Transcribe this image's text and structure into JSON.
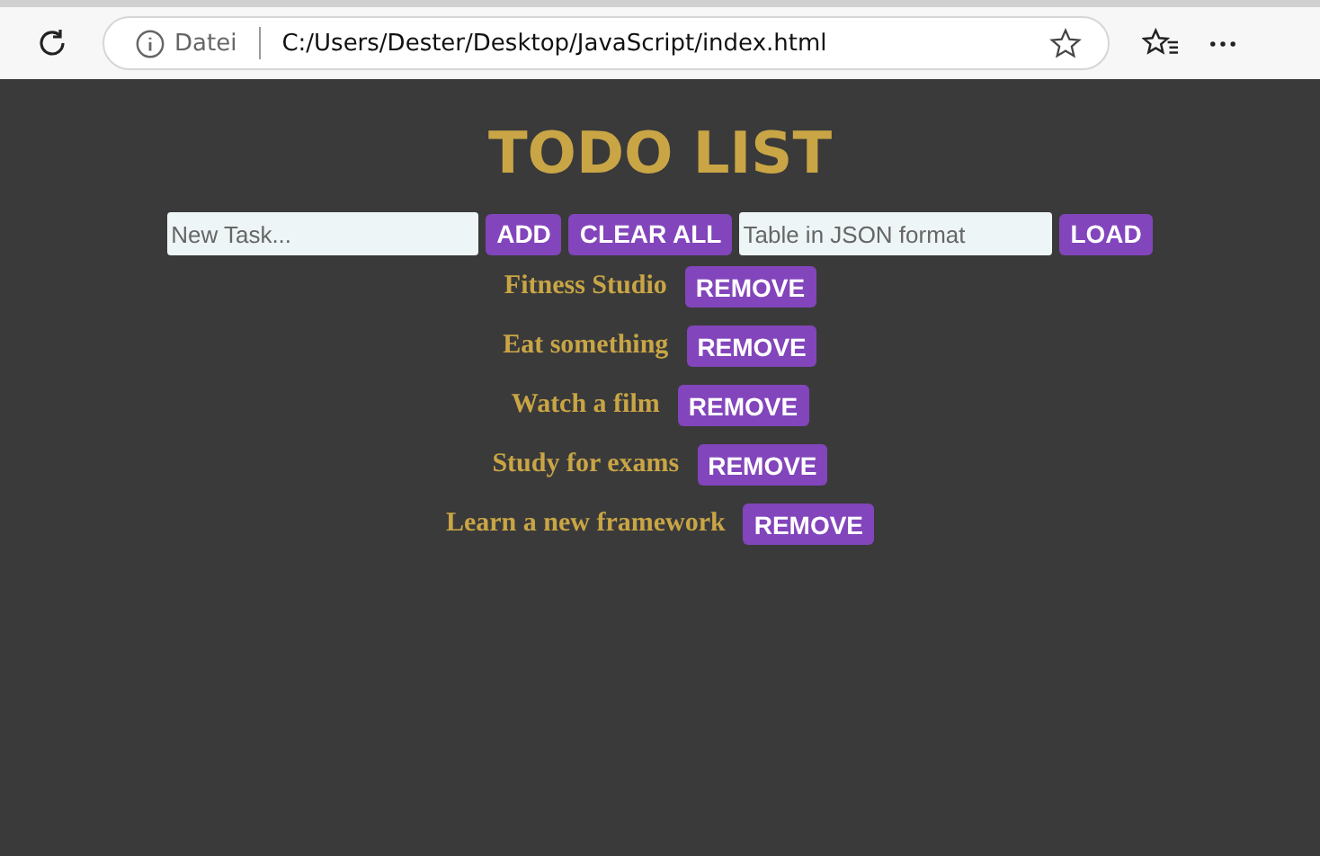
{
  "browser": {
    "site_label": "Datei",
    "address": "C:/Users/Dester/Desktop/JavaScript/index.html"
  },
  "page": {
    "title": "TODO LIST",
    "controls": [
      {
        "kind": "input",
        "placeholder": "New Task..."
      },
      {
        "kind": "button",
        "label": "ADD"
      },
      {
        "kind": "button",
        "label": "CLEAR ALL"
      },
      {
        "kind": "input",
        "placeholder": "Table in JSON format"
      },
      {
        "kind": "button",
        "label": "LOAD"
      }
    ],
    "tasks": [
      {
        "text": "Fitness Studio",
        "button": "REMOVE"
      },
      {
        "text": "Eat something",
        "button": "REMOVE"
      },
      {
        "text": "Watch a film",
        "button": "REMOVE"
      },
      {
        "text": "Study for exams",
        "button": "REMOVE"
      },
      {
        "text": "Learn a new framework",
        "button": "REMOVE"
      }
    ]
  }
}
